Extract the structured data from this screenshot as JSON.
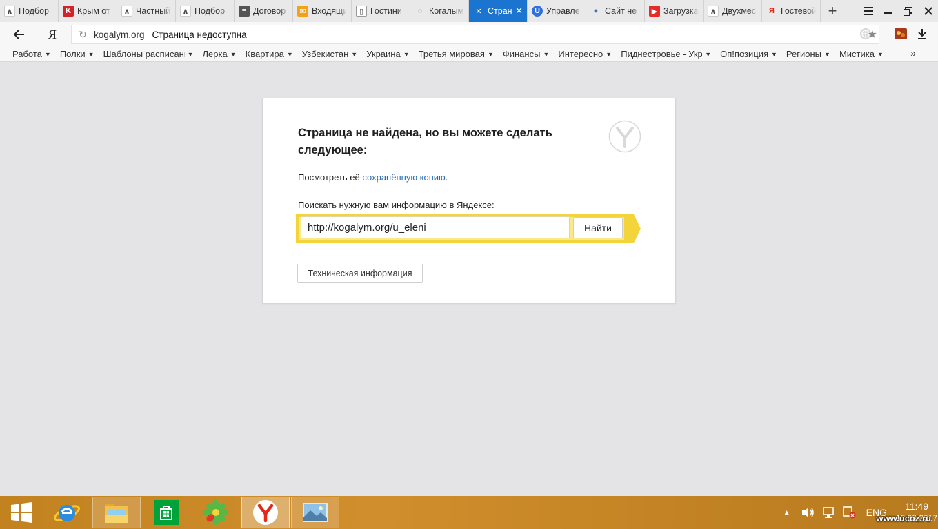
{
  "tabs": [
    {
      "title": "Подбор",
      "icon": "yandex-realty-icon"
    },
    {
      "title": "Крым от",
      "icon": "k-red-icon"
    },
    {
      "title": "Частный",
      "icon": "yandex-realty-icon"
    },
    {
      "title": "Подбор",
      "icon": "yandex-realty-icon"
    },
    {
      "title": "Договор",
      "icon": "document-icon"
    },
    {
      "title": "Входящи",
      "icon": "mail-icon"
    },
    {
      "title": "Гостини",
      "icon": "page-icon"
    },
    {
      "title": "Когалым",
      "icon": "loading-icon"
    },
    {
      "title": "Стран",
      "icon": "broken-page-icon",
      "active": true
    },
    {
      "title": "Управле",
      "icon": "ucoz-icon"
    },
    {
      "title": "Сайт не",
      "icon": "users-icon"
    },
    {
      "title": "Загрузка",
      "icon": "youtube-icon"
    },
    {
      "title": "Двухмес",
      "icon": "yandex-realty-icon"
    },
    {
      "title": "Гостевой",
      "icon": "yandex-icon"
    }
  ],
  "address": {
    "logo": "Я",
    "domain": "kogalym.org",
    "state": "Страница недоступна"
  },
  "bookmarks": [
    "Работа",
    "Полки",
    "Шаблоны расписания",
    "Лерка",
    "Квартира",
    "Узбекистан",
    "Украина",
    "Третья мировая",
    "Финансы",
    "Интересно",
    "Пиднестровье - Украина",
    "Оп!позиция",
    "Регионы",
    "Мистика"
  ],
  "bookmarks_more": "»",
  "error_page": {
    "title": "Страница не найдена, но вы можете сделать следующее:",
    "cached_prefix": "Посмотреть её ",
    "cached_link": "сохранённую копию",
    "cached_suffix": ".",
    "search_label": "Поискать нужную вам информацию в Яндексе:",
    "search_value": "http://kogalym.org/u_eleni",
    "search_button": "Найти",
    "tech_button": "Техническая информация"
  },
  "taskbar": {
    "apps": [
      {
        "name": "internet-explorer",
        "icon": "ie-icon"
      },
      {
        "name": "file-explorer",
        "icon": "folder-icon"
      },
      {
        "name": "store",
        "icon": "store-icon"
      },
      {
        "name": "icq",
        "icon": "icq-flower-icon"
      },
      {
        "name": "yandex-browser",
        "icon": "yandex-browser-icon",
        "active": true
      },
      {
        "name": "photos",
        "icon": "photo-viewer-icon"
      }
    ],
    "language": "ENG",
    "time": "11:49",
    "date": "13.03.2017",
    "watermark": "www.ucoz.ru"
  },
  "colors": {
    "active_tab": "#1b75d0",
    "link": "#2a6bb3",
    "search_accent": "#f3d43a",
    "taskbar": "#c98825"
  }
}
